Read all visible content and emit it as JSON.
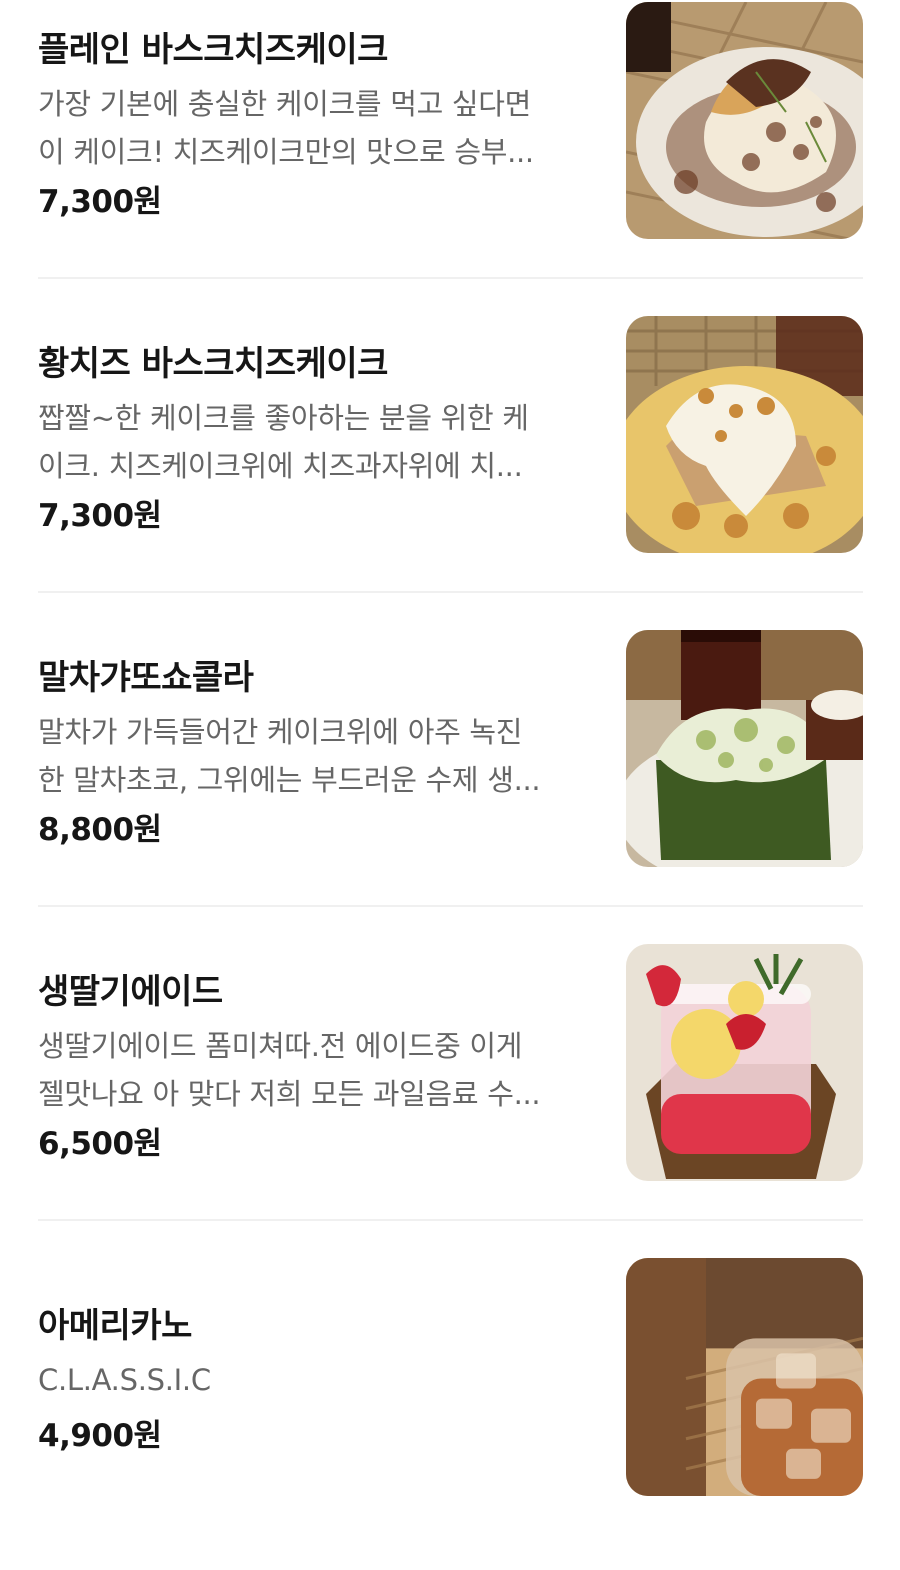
{
  "menu": {
    "items": [
      {
        "name": "플레인 바스크치즈케이크",
        "description_lines": [
          "가장 기본에 충실한 케이크를 먹고 싶다면",
          "이 케이크! 치즈케이크만의 맛으로 승부..."
        ],
        "price": "7,300원",
        "image_icon": "cheesecake-cocoa-photo"
      },
      {
        "name": "황치즈 바스크치즈케이크",
        "description_lines": [
          "짭짤~한 케이크를 좋아하는 분을 위한 케",
          "이크. 치즈케이크위에 치즈과자위에 치..."
        ],
        "price": "7,300원",
        "image_icon": "yellow-cheesecake-photo"
      },
      {
        "name": "말차갸또쇼콜라",
        "description_lines": [
          "말차가 가득들어간 케이크위에 아주 녹진",
          "한 말차초코, 그위에는 부드러운 수제 생..."
        ],
        "price": "8,800원",
        "image_icon": "matcha-cake-photo"
      },
      {
        "name": "생딸기에이드",
        "description_lines": [
          "생딸기에이드 폼미쳐따.전 에이드중 이게",
          "젤맛나요 아 맞다 저희 모든 과일음료 수..."
        ],
        "price": "6,500원",
        "image_icon": "strawberry-ade-photo"
      },
      {
        "name": "아메리카노",
        "description_lines": [
          "C.L.A.S.S.I.C"
        ],
        "price": "4,900원",
        "image_icon": "iced-americano-photo"
      }
    ]
  },
  "colors": {
    "name_text": "#161616",
    "description_text": "#666666",
    "divider": "#f0f0f0",
    "background": "#ffffff"
  }
}
